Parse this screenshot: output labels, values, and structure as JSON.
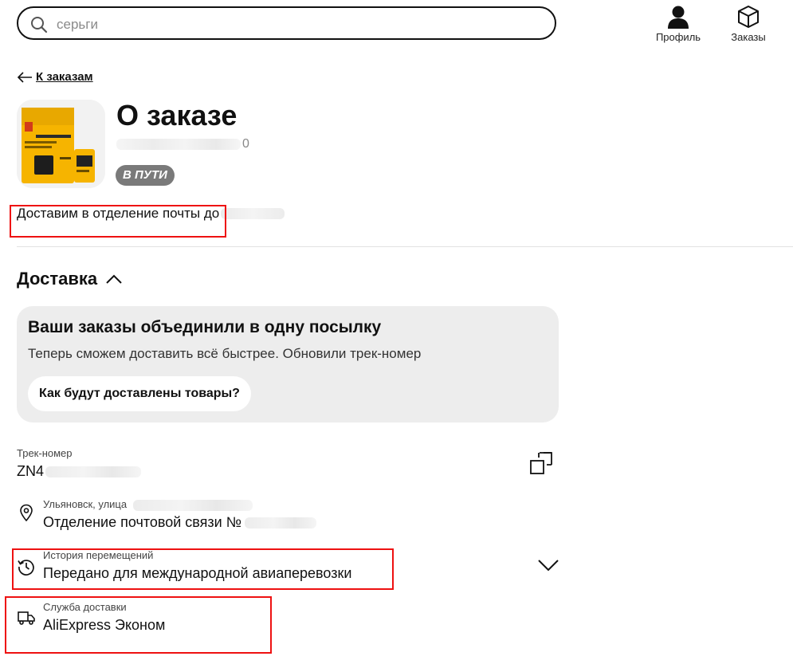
{
  "header": {
    "search": {
      "value": "серьги",
      "icon": "search-icon"
    },
    "nav": [
      {
        "label": "Профиль",
        "icon": "user-icon"
      },
      {
        "label": "Заказы",
        "icon": "box-icon"
      }
    ]
  },
  "back_link": {
    "label": "К заказам",
    "icon": "arrow-left-icon"
  },
  "order": {
    "title": "О заказе",
    "number_suffix": "0",
    "status": "В ПУТИ",
    "delivery_note": "Доставим в отделение почты до"
  },
  "delivery": {
    "title": "Доставка",
    "card": {
      "title": "Ваши заказы объединили в одну посылку",
      "text": "Теперь сможем доставить всё быстрее. Обновили трек-номер",
      "button": "Как будут доставлены товары?"
    },
    "track": {
      "label": "Трек-номер",
      "value": "ZN4"
    },
    "address": {
      "line1": "Ульяновск, улица",
      "line2": "Отделение почтовой связи №"
    },
    "history": {
      "label": "История перемещений",
      "value": "Передано для международной авиаперевозки"
    },
    "service": {
      "label": "Служба доставки",
      "value": "AliExpress Эконом"
    }
  },
  "colors": {
    "accent": "#111111",
    "badge": "#7a7a7a",
    "card_bg": "#ededed",
    "highlight": "#e11111"
  }
}
